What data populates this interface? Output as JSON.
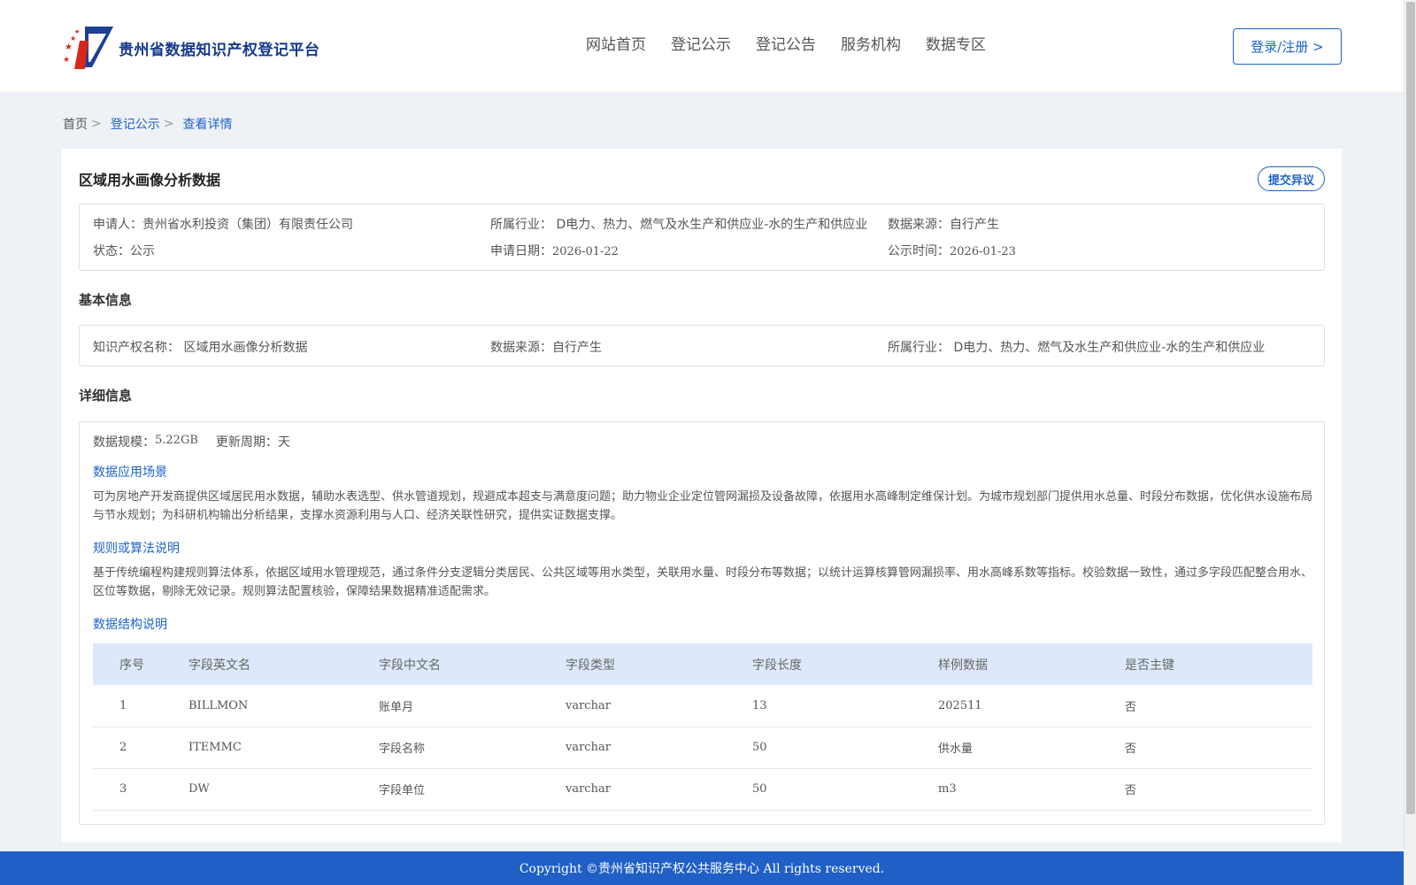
{
  "header": {
    "platform_title": "贵州省数据知识产权登记平台",
    "nav": [
      "网站首页",
      "登记公示",
      "登记公告",
      "服务机构",
      "数据专区"
    ],
    "login_label": "登录/注册 >"
  },
  "breadcrumb": {
    "home": "首页",
    "sep": ">",
    "level1": "登记公示",
    "current": "查看详情"
  },
  "detail": {
    "title": "区域用水画像分析数据",
    "objection_label": "提交异议",
    "summary": {
      "applicant_label": "申请人：",
      "applicant": "贵州省水利投资（集团）有限责任公司",
      "industry_label": "所属行业：",
      "industry": "D电力、热力、燃气及水生产和供应业-水的生产和供应业",
      "source_label": "数据来源：",
      "source": "自行产生",
      "status_label": "状态：",
      "status": "公示",
      "apply_date_label": "申请日期：",
      "apply_date": "2026-01-22",
      "publish_time_label": "公示时间：",
      "publish_time": "2026-01-23"
    },
    "basic_title": "基本信息",
    "basic": {
      "ip_name_label": "知识产权名称：",
      "ip_name": "区域用水画像分析数据",
      "source_label": "数据来源：",
      "source": "自行产生",
      "industry_label": "所属行业：",
      "industry": "D电力、热力、燃气及水生产和供应业-水的生产和供应业"
    },
    "detail_title": "详细信息",
    "scale_label": "数据规模：",
    "scale": "5.22GB",
    "cycle_label": "更新周期：",
    "cycle": "天",
    "scenario_title": "数据应用场景",
    "scenario_text": "可为房地产开发商提供区域居民用水数据，辅助水表选型、供水管道规划，规避成本超支与满意度问题；助力物业企业定位管网漏损及设备故障，依据用水高峰制定维保计划。为城市规划部门提供用水总量、时段分布数据，优化供水设施布局与节水规划；为科研机构输出分析结果，支撑水资源利用与人口、经济关联性研究，提供实证数据支撑。",
    "algorithm_title": "规则或算法说明",
    "algorithm_text": "基于传统编程构建规则算法体系，依据区域用水管理规范，通过条件分支逻辑分类居民、公共区域等用水类型，关联用水量、时段分布等数据；以统计运算核算管网漏损率、用水高峰系数等指标。校验数据一致性，通过多字段匹配整合用水、区位等数据，剔除无效记录。规则算法配置核验，保障结果数据精准适配需求。",
    "structure_title": "数据结构说明",
    "table_headers": [
      "序号",
      "字段英文名",
      "字段中文名",
      "字段类型",
      "字段长度",
      "样例数据",
      "是否主键"
    ],
    "table_rows": [
      [
        "1",
        "BILLMON",
        "账单月",
        "varchar",
        "13",
        "202511",
        "否"
      ],
      [
        "2",
        "ITEMMC",
        "字段名称",
        "varchar",
        "50",
        "供水量",
        "否"
      ],
      [
        "3",
        "DW",
        "字段单位",
        "varchar",
        "50",
        "m3",
        "否"
      ]
    ]
  },
  "footer": {
    "copyright": "Copyright ©贵州省知识产权公共服务中心 All rights reserved."
  },
  "colors": {
    "brand_blue": "#1e63c9",
    "footer_blue": "#1f5fc6",
    "table_header_bg": "#dde9fa",
    "page_bg": "#eef1f5"
  }
}
